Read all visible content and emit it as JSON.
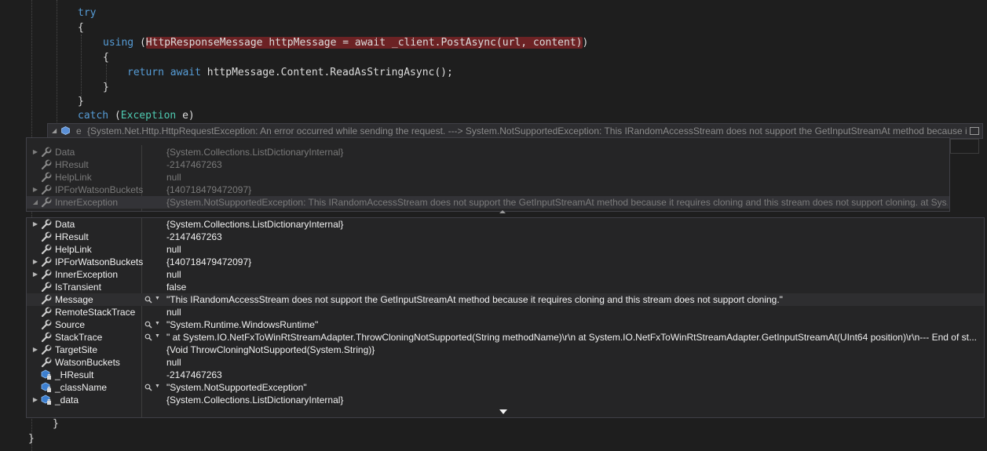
{
  "code": {
    "try_kw": "try",
    "brace_open_1": "{",
    "using_kw": "using",
    "using_paren": " (",
    "using_expr": "HttpResponseMessage httpMessage = await _client.PostAsync(url, content)",
    "using_close": ")",
    "brace_open_2": "{",
    "return_kw": "return",
    "await_kw": "await",
    "return_rest": " httpMessage.Content.ReadAsStringAsync();",
    "brace_close_2": "}",
    "brace_close_1": "}",
    "catch_kw": "catch",
    "catch_paren": " (",
    "catch_type": "Exception",
    "catch_rest": " e)",
    "end_brace_1": "}",
    "end_brace_2": "}"
  },
  "tip": {
    "var": "e",
    "value": "{System.Net.Http.HttpRequestException: An error occurred while sending the request. ---> System.NotSupportedException: This IRandomAccessStream does not support the GetInputStreamAt method because it ..."
  },
  "outer_rows": [
    {
      "name": "Data",
      "value": "{System.Collections.ListDictionaryInternal}",
      "expandable": true
    },
    {
      "name": "HResult",
      "value": "-2147467263",
      "expandable": false
    },
    {
      "name": "HelpLink",
      "value": "null",
      "expandable": false
    },
    {
      "name": "IPForWatsonBuckets",
      "value": "{140718479472097}",
      "expandable": true
    },
    {
      "name": "InnerException",
      "value": "{System.NotSupportedException: This IRandomAccessStream does not support the GetInputStreamAt method because it requires cloning and this stream does not support cloning.    at Sys...",
      "expandable": true
    }
  ],
  "inner_rows": [
    {
      "name": "Data",
      "value": "{System.Collections.ListDictionaryInternal}",
      "expandable": true,
      "icon": "wrench",
      "mag": false
    },
    {
      "name": "HResult",
      "value": "-2147467263",
      "expandable": false,
      "icon": "wrench",
      "mag": false
    },
    {
      "name": "HelpLink",
      "value": "null",
      "expandable": false,
      "icon": "wrench",
      "mag": false
    },
    {
      "name": "IPForWatsonBuckets",
      "value": "{140718479472097}",
      "expandable": true,
      "icon": "wrench",
      "mag": false
    },
    {
      "name": "InnerException",
      "value": "null",
      "expandable": true,
      "icon": "wrench",
      "mag": false
    },
    {
      "name": "IsTransient",
      "value": "false",
      "expandable": false,
      "icon": "wrench",
      "mag": false
    },
    {
      "name": "Message",
      "value": "\"This IRandomAccessStream does not support the GetInputStreamAt method because it requires cloning and this stream does not support cloning.\"",
      "expandable": false,
      "icon": "wrench",
      "mag": true
    },
    {
      "name": "RemoteStackTrace",
      "value": "null",
      "expandable": false,
      "icon": "wrench",
      "mag": false
    },
    {
      "name": "Source",
      "value": "\"System.Runtime.WindowsRuntime\"",
      "expandable": false,
      "icon": "wrench",
      "mag": true
    },
    {
      "name": "StackTrace",
      "value": "\"   at System.IO.NetFxToWinRtStreamAdapter.ThrowCloningNotSupported(String methodName)\\r\\n   at System.IO.NetFxToWinRtStreamAdapter.GetInputStreamAt(UInt64 position)\\r\\n--- End of st...",
      "expandable": false,
      "icon": "wrench",
      "mag": true
    },
    {
      "name": "TargetSite",
      "value": "{Void ThrowCloningNotSupported(System.String)}",
      "expandable": true,
      "icon": "wrench",
      "mag": false
    },
    {
      "name": "WatsonBuckets",
      "value": "null",
      "expandable": false,
      "icon": "wrench",
      "mag": false
    },
    {
      "name": "_HResult",
      "value": "-2147467263",
      "expandable": false,
      "icon": "field",
      "mag": false
    },
    {
      "name": "_className",
      "value": "\"System.NotSupportedException\"",
      "expandable": false,
      "icon": "field",
      "mag": true
    },
    {
      "name": "_data",
      "value": "{System.Collections.ListDictionaryInternal}",
      "expandable": true,
      "icon": "field",
      "mag": false
    }
  ],
  "icons": {
    "expand": "triangle-right",
    "expanded": "triangle-down",
    "property": "wrench-icon",
    "field": "private-field-icon",
    "visualizer": "magnifier-icon"
  },
  "colors": {
    "editor_bg": "#1e1e1e",
    "keyword": "#569cd6",
    "type": "#4ec9b0",
    "error_highlight": "#6c2224",
    "datatip_bg": "#252526",
    "datatip_border": "#3f3f46"
  }
}
